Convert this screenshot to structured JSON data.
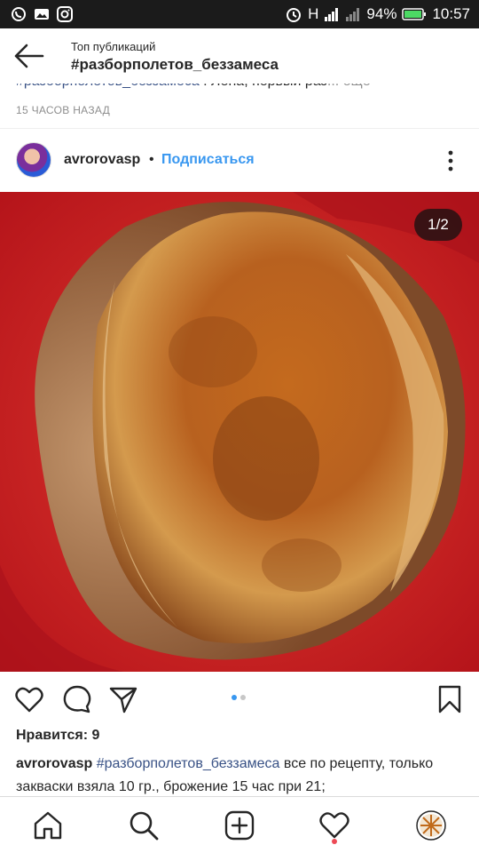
{
  "status_bar": {
    "time": "10:57",
    "battery": "94%",
    "network": "H",
    "icons": [
      "viber-icon",
      "gallery-icon",
      "instagram-icon",
      "alarm-icon",
      "signal-icon",
      "signal-icon",
      "battery-icon"
    ]
  },
  "header": {
    "kicker": "Топ публикаций",
    "title": "#разборполетов_беззамеса"
  },
  "previous_post": {
    "caption_tag": "#разборполетов_беззамеса",
    "caption_text": " : Лена, первый раз",
    "more": "... ещё",
    "time": "15 ЧАСОВ НАЗАД"
  },
  "post": {
    "username": "avrorovasp",
    "separator": "•",
    "follow_label": "Подписаться",
    "image_counter": "1/2",
    "likes": "Нравится: 9",
    "caption_user": "avrorovasp",
    "caption_tag": "#разборполетов_беззамеса",
    "caption_text": " все по рецепту, только закваски взяла 10 гр., брожение 15 час при 21;",
    "carousel_active_index": 0,
    "carousel_count": 2
  },
  "colors": {
    "link": "#3897f0",
    "hashtag": "#385185",
    "muted": "#8e8e8e",
    "notification": "#ed4956",
    "image_background": "#d0201f"
  },
  "bottom_nav": [
    "home-icon",
    "search-icon",
    "new-post-icon",
    "activity-icon",
    "profile-avatar"
  ]
}
